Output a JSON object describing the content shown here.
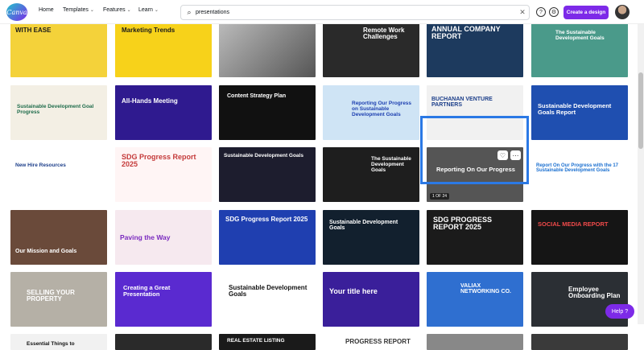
{
  "brand": {
    "logo_text": "Canva"
  },
  "nav": {
    "home": "Home",
    "templates": "Templates",
    "features": "Features",
    "learn": "Learn"
  },
  "search": {
    "value": "presentations"
  },
  "actions": {
    "create": "Create a design",
    "help": "Help ?"
  },
  "cards": {
    "r0": [
      "WITH EASE",
      "Marketing Trends",
      "",
      "Remote Work Challenges",
      "ANNUAL COMPANY REPORT",
      "The Sustainable Development Goals"
    ],
    "r1": [
      "Sustainable Development Goal Progress",
      "All-Hands Meeting",
      "Content Strategy Plan",
      "Reporting Our Progress on Sustainable Development Goals",
      "BUCHANAN VENTURE PARTNERS",
      "Sustainable Development Goals Report"
    ],
    "r2": [
      "New Hire Resources",
      "SDG Progress Report 2025",
      "Sustainable Development Goals",
      "The Sustainable Development Goals",
      "Reporting On Our Progress",
      "Report On Our Progress with the 17 Sustainable Development Goals"
    ],
    "r3": [
      "Our Mission and Goals",
      "Paving the Way",
      "SDG Progress Report 2025",
      "Sustainable Development Goals",
      "SDG PROGRESS REPORT 2025",
      "SOCIAL MEDIA REPORT"
    ],
    "r4": [
      "SELLING YOUR PROPERTY",
      "Creating a Great Presentation",
      "Sustainable Development Goals",
      "Your title here",
      "VALIAX NETWORKING CO.",
      "Employee Onboarding Plan"
    ],
    "r5": [
      "Essential Things to",
      "",
      "REAL ESTATE LISTING",
      "PROGRESS REPORT",
      "",
      ""
    ]
  },
  "selected_badge": "1 OF 24"
}
